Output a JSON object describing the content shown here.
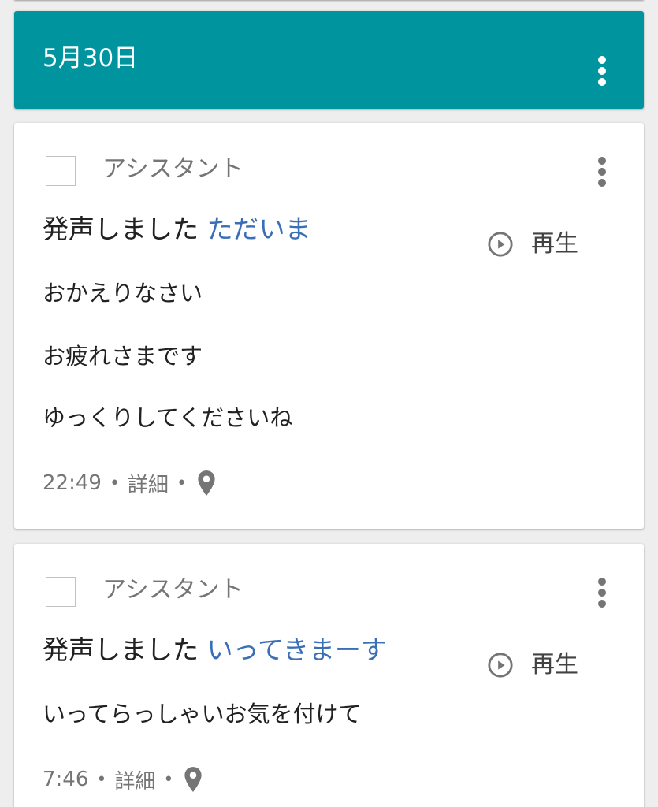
{
  "colors": {
    "header_bg": "#00949f",
    "query_accent": "#3a6fb8",
    "icon_gray": "#757575"
  },
  "header": {
    "date": "5月30日",
    "menu_icon": "more-vert-icon"
  },
  "entries": [
    {
      "source": "アシスタント",
      "query_prefix": "発声しました",
      "query_text": "ただいま",
      "play_label": "再生",
      "responses": [
        "おかえりなさい",
        "お疲れさまです",
        "ゆっくりしてくださいね"
      ],
      "time": "22:49",
      "separator": "•",
      "details_label": "詳細",
      "location_icon": "location-pin-icon"
    },
    {
      "source": "アシスタント",
      "query_prefix": "発声しました",
      "query_text": "いってきまーす",
      "play_label": "再生",
      "responses": [
        "いってらっしゃいお気を付けて"
      ],
      "time": "7:46",
      "separator": "•",
      "details_label": "詳細",
      "location_icon": "location-pin-icon"
    }
  ]
}
